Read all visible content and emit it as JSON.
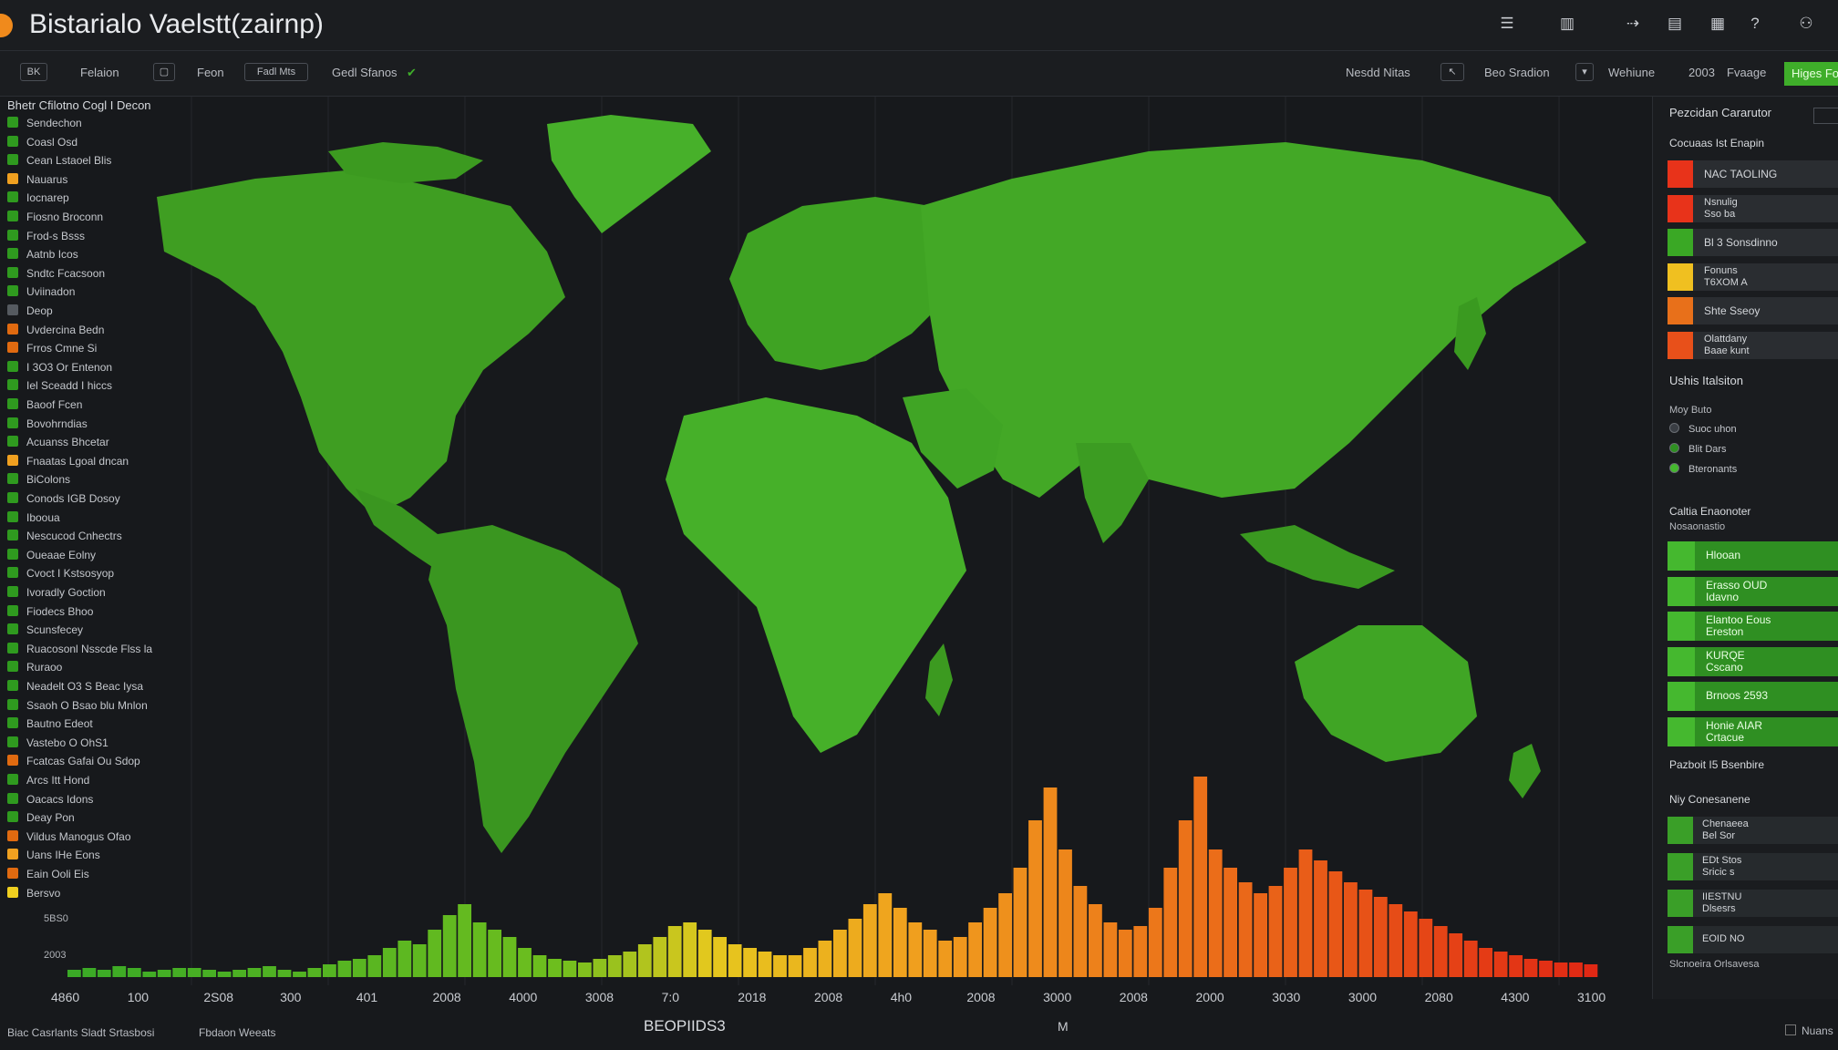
{
  "app": {
    "title": "Bistarialo Vaelstt(zairnp)"
  },
  "titlebar_icons": [
    "menu-icon",
    "library-icon",
    "cursor-icon",
    "layout-icon",
    "grid-icon",
    "help-icon",
    "user-icon"
  ],
  "toolbar": {
    "items": [
      "BK",
      "Felaion",
      "Feon",
      "Fadl Mts",
      "Gedl Sfanos",
      "Nesdd Nitas",
      "Beo Sradion",
      "Wehiune",
      "2003",
      "Fvaage"
    ],
    "go_label": "Higes Fo"
  },
  "left_list": {
    "heading": "Bhetr Cfilotno Cogl I Decon",
    "items": [
      {
        "label": "Sendechon",
        "color": "#2f9a1f"
      },
      {
        "label": "Coasl Osd",
        "color": "#2f9a1f"
      },
      {
        "label": "Cean Lstaoel Blis",
        "color": "#2f9a1f"
      },
      {
        "label": "Nauarus",
        "color": "#f0a020"
      },
      {
        "label": "Iocnarep",
        "color": "#2f9a1f"
      },
      {
        "label": "Fiosno Broconn",
        "color": "#2f9a1f"
      },
      {
        "label": "Frod-s Bsss",
        "color": "#2f9a1f"
      },
      {
        "label": "Aatnb Icos",
        "color": "#2f9a1f"
      },
      {
        "label": "Sndtc Fcacsoon",
        "color": "#2f9a1f"
      },
      {
        "label": "Uviinadon",
        "color": "#2f9a1f"
      },
      {
        "label": "Deop",
        "color": "#555a60"
      },
      {
        "label": "Uvdercina Bedn",
        "color": "#e06a10"
      },
      {
        "label": "Frros Cmne Si",
        "color": "#e06a10"
      },
      {
        "label": "I 3O3 Or Entenon",
        "color": "#2f9a1f"
      },
      {
        "label": "Iel Sceadd I hiccs",
        "color": "#2f9a1f"
      },
      {
        "label": "Baoof Fcen",
        "color": "#2f9a1f"
      },
      {
        "label": "Bovohrndias",
        "color": "#2f9a1f"
      },
      {
        "label": "Acuanss Bhcetar",
        "color": "#2f9a1f"
      },
      {
        "label": "Fnaatas Lgoal dncan",
        "color": "#f0a020"
      },
      {
        "label": "BiColons",
        "color": "#2f9a1f"
      },
      {
        "label": "Conods IGB Dosoy",
        "color": "#2f9a1f"
      },
      {
        "label": "Ibooua",
        "color": "#2f9a1f"
      },
      {
        "label": "Nescucod Cnhectrs",
        "color": "#2f9a1f"
      },
      {
        "label": "Oueaae Eolny",
        "color": "#2f9a1f"
      },
      {
        "label": "Cvoct I Kstsosyop",
        "color": "#2f9a1f"
      },
      {
        "label": "Ivoradly Goction",
        "color": "#2f9a1f"
      },
      {
        "label": "Fiodecs Bhoo",
        "color": "#2f9a1f"
      },
      {
        "label": "Scunsfecey",
        "color": "#2f9a1f"
      },
      {
        "label": "Ruacosonl Nsscde Flss la",
        "color": "#2f9a1f"
      },
      {
        "label": "Ruraoo",
        "color": "#2f9a1f"
      },
      {
        "label": "Neadelt O3 S Beac Iysa",
        "color": "#2f9a1f"
      },
      {
        "label": "Ssaoh O Bsao blu Mnlon",
        "color": "#2f9a1f"
      },
      {
        "label": "Bautno Edeot",
        "color": "#2f9a1f"
      },
      {
        "label": "Vastebo O OhS1",
        "color": "#2f9a1f"
      },
      {
        "label": "Fcatcas Gafai Ou Sdop",
        "color": "#e06a10"
      },
      {
        "label": "Arcs Itt Hond",
        "color": "#2f9a1f"
      },
      {
        "label": "Oacacs Idons",
        "color": "#2f9a1f"
      },
      {
        "label": "Deay Pon",
        "color": "#2f9a1f"
      },
      {
        "label": "Vildus Manogus Ofao",
        "color": "#e06a10"
      },
      {
        "label": "Uans IHe Eons",
        "color": "#f0a020"
      },
      {
        "label": "Eain Ooli Eis",
        "color": "#e06a10"
      },
      {
        "label": "Bersvo",
        "color": "#f0d020"
      }
    ]
  },
  "chart": {
    "y_top_label": "5BS0",
    "y_bottom_label": "2003",
    "x_labels": [
      "4860",
      "100",
      "2S08",
      "300",
      "401",
      "2008",
      "4000",
      "3008",
      "7:0",
      "2018",
      "2008",
      "4h0",
      "2008",
      "3000",
      "2008",
      "2000",
      "3030",
      "3000",
      "2080",
      "4300",
      "3100"
    ],
    "x_title": "BEOPIIDS3",
    "x_marker": "M"
  },
  "chart_data": {
    "type": "bar",
    "title": "",
    "xlabel": "BEOPIIDS3",
    "ylabel": "",
    "x": [
      "4860",
      "100",
      "2S08",
      "300",
      "401",
      "2008",
      "4000",
      "3008",
      "7:0",
      "2018",
      "2008",
      "4h0",
      "2008",
      "3000",
      "2008",
      "2000",
      "3030",
      "3000",
      "2080",
      "4300",
      "3100"
    ],
    "values": [
      4,
      5,
      4,
      6,
      5,
      3,
      4,
      5,
      5,
      4,
      3,
      4,
      5,
      6,
      4,
      3,
      5,
      7,
      9,
      10,
      12,
      16,
      20,
      18,
      26,
      34,
      40,
      30,
      26,
      22,
      16,
      12,
      10,
      9,
      8,
      10,
      12,
      14,
      18,
      22,
      28,
      30,
      26,
      22,
      18,
      16,
      14,
      12,
      12,
      16,
      20,
      26,
      32,
      40,
      46,
      38,
      30,
      26,
      20,
      22,
      30,
      38,
      46,
      60,
      86,
      104,
      70,
      50,
      40,
      30,
      26,
      28,
      38,
      60,
      86,
      110,
      70,
      60,
      52,
      46,
      50,
      60,
      70,
      64,
      58,
      52,
      48,
      44,
      40,
      36,
      32,
      28,
      24,
      20,
      16,
      14,
      12,
      10,
      9,
      8,
      8,
      7
    ],
    "colors_by_x": "green-yellow-orange-red gradient left to right"
  },
  "right_panel": {
    "title": "Pezcidan Cararutor",
    "section1": "Cocuaas Ist Enapin",
    "rows": [
      {
        "color": "#e8331a",
        "line1": "NAC TAOLING",
        "line2": ""
      },
      {
        "color": "#e8331a",
        "line1": "Nsnulig",
        "line2": "Sso ba"
      },
      {
        "color": "#3aa825",
        "line1": "Bl 3 Sonsdinno",
        "line2": ""
      },
      {
        "color": "#f0c020",
        "line1": "Fonuns",
        "line2": "T6XOM A"
      },
      {
        "color": "#e8701a",
        "line1": "Shte Sseoy",
        "line2": ""
      },
      {
        "color": "#e8501a",
        "line1": "Olattdany",
        "line2": "Baae kunt"
      }
    ],
    "section2": "Ushis Italsiton",
    "section2_sub": "Moy Buto",
    "status_items": [
      {
        "label": "Suoc uhon",
        "color": "#3a3e44"
      },
      {
        "label": "Blit Dars",
        "color": "#2f8f22"
      },
      {
        "label": "Bteronants",
        "color": "#45b82f"
      }
    ],
    "section3": "Caltia Enaonoter",
    "section3_sub": "Nosaonastio",
    "green_rows": [
      {
        "line1": "Hlooan",
        "line2": ""
      },
      {
        "line1": "Erasso OUD",
        "line2": "Idavno"
      },
      {
        "line1": "Elantoo Eous",
        "line2": "Ereston"
      },
      {
        "line1": "KURQE",
        "line2": "Cscano"
      },
      {
        "line1": "Brnoos 2593",
        "line2": ""
      },
      {
        "line1": "Honie AIAR",
        "line2": "Crtacue"
      }
    ],
    "section4": "Pazboit I5 Bsenbire",
    "section5": "Niy Conesanene",
    "bottom_rows": [
      {
        "line1": "Chenaeea",
        "line2": "Bel Sor"
      },
      {
        "line1": "EDt Stos",
        "line2": "Sricic s"
      },
      {
        "line1": "IIESTNU",
        "line2": "Dlsesrs"
      },
      {
        "line1": "EOID NO",
        "line2": ""
      }
    ],
    "footer": "Slcnoeira  Orlsavesa"
  },
  "footer": {
    "left": "Biac Casrlants Sladt Srtasbosi",
    "mid": "Fbdaon Weeats",
    "right": "Nuans"
  },
  "colors": {
    "accent": "#3fae2a",
    "background": "#17191c"
  }
}
